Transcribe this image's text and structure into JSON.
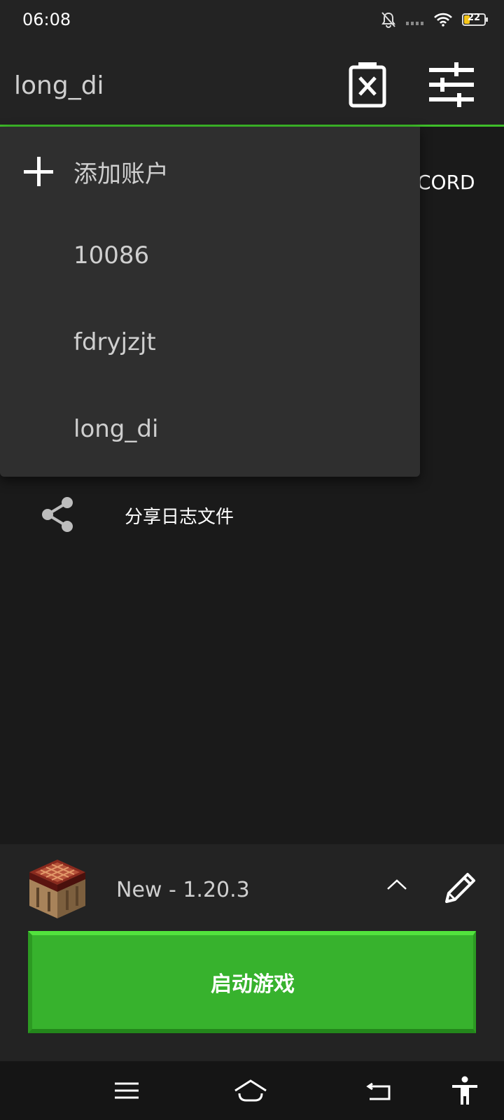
{
  "status_bar": {
    "time": "06:08",
    "battery_level": "22"
  },
  "app_bar": {
    "account_name": "long_di"
  },
  "background": {
    "discord_text": "CORD",
    "share_label": "分享日志文件"
  },
  "account_menu": {
    "add_label": "添加账户",
    "accounts": [
      "10086",
      "fdryjzjt",
      "long_di"
    ]
  },
  "bottom": {
    "version_label": "New - 1.20.3",
    "launch_label": "启动游戏"
  },
  "colors": {
    "accent": "#3fbf2a",
    "launch_button": "#37b22d",
    "surface": "#232323",
    "menu": "#2f2f2f"
  }
}
